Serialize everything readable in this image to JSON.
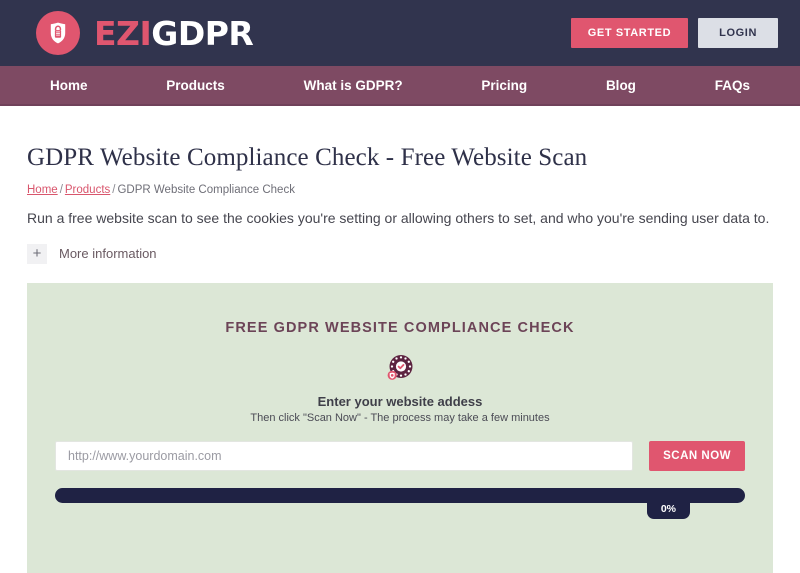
{
  "header": {
    "logo": {
      "icon": "shield-lock-icon",
      "text_primary": "EZI",
      "text_secondary": "GDPR"
    },
    "get_started_label": "GET STARTED",
    "login_label": "LOGIN"
  },
  "nav": {
    "items": [
      {
        "label": "Home"
      },
      {
        "label": "Products"
      },
      {
        "label": "What is GDPR?"
      },
      {
        "label": "Pricing"
      },
      {
        "label": "Blog"
      },
      {
        "label": "FAQs"
      }
    ]
  },
  "main": {
    "page_title": "GDPR Website Compliance Check - Free Website Scan",
    "breadcrumb": {
      "home": "Home",
      "products": "Products",
      "current": "GDPR Website Compliance Check",
      "separator": "/"
    },
    "lede": "Run a free website scan to see the cookies you're setting or allowing others to set, and who you're sending user data to.",
    "more_information": {
      "toggle_icon": "plus-icon",
      "toggle_symbol": "+",
      "label": "More information"
    }
  },
  "scan_panel": {
    "heading": "FREE GDPR WEBSITE COMPLIANCE CHECK",
    "icon": "gdpr-check-badge-icon",
    "subheading": "Enter your website addess",
    "subtext": "Then click \"Scan Now\" - The process may take a few minutes",
    "input": {
      "value": "",
      "placeholder": "http://www.yourdomain.com"
    },
    "scan_button_label": "SCAN NOW",
    "progress": {
      "percent_label": "0%",
      "value": 0
    }
  },
  "colors": {
    "header_bg": "#31344e",
    "nav_bg": "#7e4a63",
    "accent_pink": "#e0566f",
    "panel_green": "#dce7d6",
    "progress_navy": "#1f2244",
    "heading_maroon": "#6c4457"
  }
}
